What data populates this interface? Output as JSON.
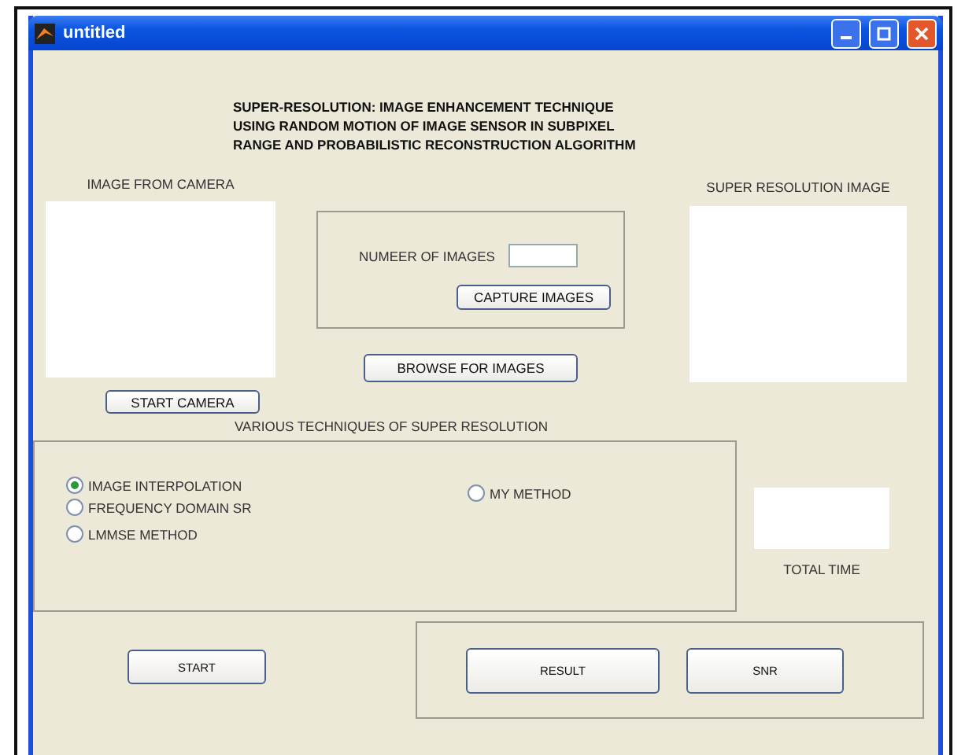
{
  "window": {
    "title": "untitled"
  },
  "heading": [
    "SUPER-RESOLUTION: IMAGE ENHANCEMENT TECHNIQUE",
    "USING RANDOM MOTION OF IMAGE SENSOR IN SUBPIXEL",
    "RANGE AND PROBABILISTIC RECONSTRUCTION ALGORITHM"
  ],
  "camera": {
    "label": "IMAGE FROM CAMERA",
    "button": "START CAMERA"
  },
  "capture": {
    "label": "NUMEER OF IMAGES",
    "button": "CAPTURE IMAGES",
    "browse": "BROWSE FOR IMAGES"
  },
  "result_image": {
    "label": "SUPER RESOLUTION IMAGE"
  },
  "techniques": {
    "title": "VARIOUS TECHNIQUES OF SUPER RESOLUTION",
    "options": [
      {
        "label": "IMAGE INTERPOLATION",
        "selected": true
      },
      {
        "label": "FREQUENCY DOMAIN SR",
        "selected": false
      },
      {
        "label": "LMMSE METHOD",
        "selected": false
      },
      {
        "label": "MY METHOD",
        "selected": false
      }
    ]
  },
  "total_time": {
    "label": "TOTAL TIME"
  },
  "buttons": {
    "start": "START",
    "result": "RESULT",
    "snr": "SNR"
  }
}
